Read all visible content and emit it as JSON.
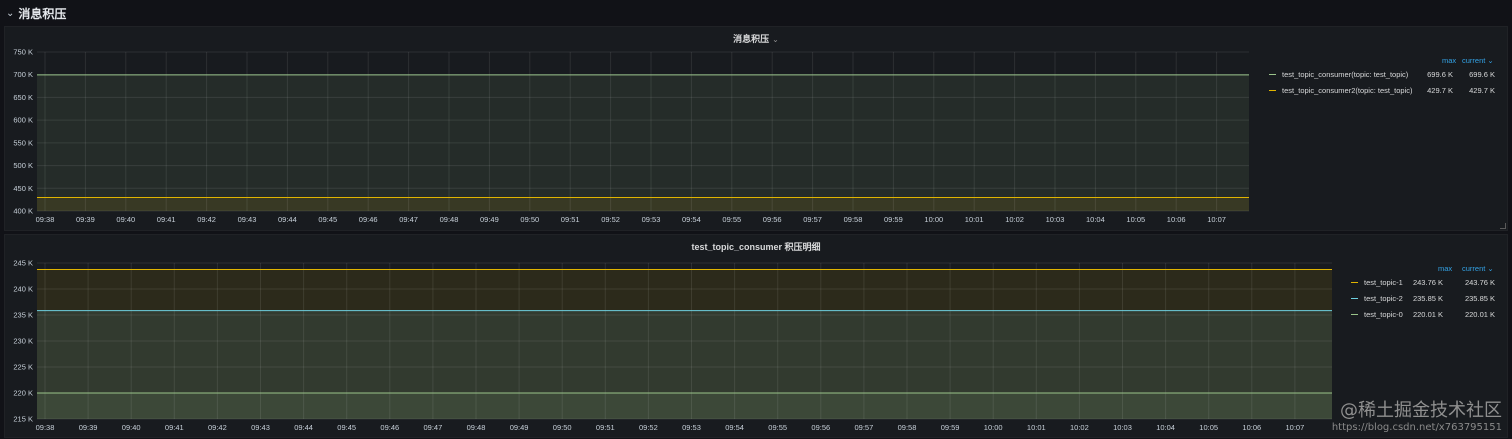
{
  "row": {
    "title": "消息积压",
    "chevron": "⌄"
  },
  "legend_headers": {
    "max": "max",
    "current": "current ⌄"
  },
  "panels": [
    {
      "title": "消息积压",
      "title_caret": "⌄",
      "legend": [
        {
          "name": "test_topic_consumer(topic: test_topic)",
          "max": "699.6 K",
          "current": "699.6 K",
          "color": "#9ac48a"
        },
        {
          "name": "test_topic_consumer2(topic: test_topic)",
          "max": "429.7 K",
          "current": "429.7 K",
          "color": "#e0b400"
        }
      ]
    },
    {
      "title": "test_topic_consumer 积压明细",
      "legend": [
        {
          "name": "test_topic-1",
          "max": "243.76 K",
          "current": "243.76 K",
          "color": "#e0b400"
        },
        {
          "name": "test_topic-2",
          "max": "235.85 K",
          "current": "235.85 K",
          "color": "#6ed0e0"
        },
        {
          "name": "test_topic-0",
          "max": "220.01 K",
          "current": "220.01 K",
          "color": "#9ac48a"
        }
      ]
    }
  ],
  "chart_data": [
    {
      "type": "area",
      "title": "消息积压",
      "x": [
        "09:38",
        "09:39",
        "09:40",
        "09:41",
        "09:42",
        "09:43",
        "09:44",
        "09:45",
        "09:46",
        "09:47",
        "09:48",
        "09:49",
        "09:50",
        "09:51",
        "09:52",
        "09:53",
        "09:54",
        "09:55",
        "09:56",
        "09:57",
        "09:58",
        "09:59",
        "10:00",
        "10:01",
        "10:02",
        "10:03",
        "10:04",
        "10:05",
        "10:06",
        "10:07"
      ],
      "y_ticks": [
        "750 K",
        "700 K",
        "650 K",
        "600 K",
        "550 K",
        "500 K",
        "450 K",
        "400 K"
      ],
      "ylim": [
        400,
        750
      ],
      "y_unit": "K",
      "grid": true,
      "legend_position": "right",
      "series": [
        {
          "name": "test_topic_consumer(topic: test_topic)",
          "value": 699.6,
          "color": "#9ac48a"
        },
        {
          "name": "test_topic_consumer2(topic: test_topic)",
          "value": 429.7,
          "color": "#e0b400"
        }
      ]
    },
    {
      "type": "area",
      "title": "test_topic_consumer 积压明细",
      "x": [
        "09:38",
        "09:39",
        "09:40",
        "09:41",
        "09:42",
        "09:43",
        "09:44",
        "09:45",
        "09:46",
        "09:47",
        "09:48",
        "09:49",
        "09:50",
        "09:51",
        "09:52",
        "09:53",
        "09:54",
        "09:55",
        "09:56",
        "09:57",
        "09:58",
        "09:59",
        "10:00",
        "10:01",
        "10:02",
        "10:03",
        "10:04",
        "10:05",
        "10:06",
        "10:07"
      ],
      "y_ticks": [
        "245 K",
        "240 K",
        "235 K",
        "230 K",
        "225 K",
        "220 K",
        "215 K"
      ],
      "ylim": [
        215,
        245
      ],
      "y_unit": "K",
      "grid": true,
      "legend_position": "right",
      "series": [
        {
          "name": "test_topic-1",
          "value": 243.76,
          "color": "#e0b400"
        },
        {
          "name": "test_topic-2",
          "value": 235.85,
          "color": "#6ed0e0"
        },
        {
          "name": "test_topic-0",
          "value": 220.01,
          "color": "#9ac48a"
        }
      ]
    }
  ],
  "watermark": {
    "line1": "@稀土掘金技术社区",
    "line2": "https://blog.csdn.net/x763795151"
  }
}
